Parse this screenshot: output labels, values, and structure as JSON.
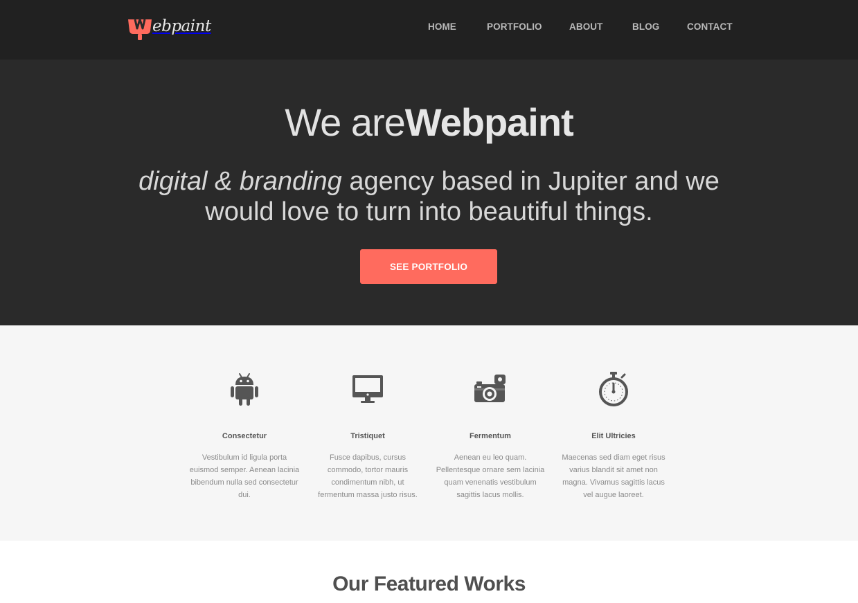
{
  "brand": {
    "name": "ebpaint",
    "logo_icon": "paint-brush-w-icon",
    "accent": "#ff6b5e"
  },
  "nav": {
    "items": [
      {
        "label": "HOME"
      },
      {
        "label": "PORTFOLIO"
      },
      {
        "label": "ABOUT"
      },
      {
        "label": "BLOG"
      },
      {
        "label": "CONTACT"
      }
    ]
  },
  "hero": {
    "title_light": "We are",
    "title_bold": "Webpaint",
    "subtitle_em": "digital & branding",
    "subtitle_rest": " agency based in Jupiter and we would love to turn into beautiful things.",
    "cta_label": "SEE PORTFOLIO"
  },
  "features": [
    {
      "icon": "android-icon",
      "title": "Consectetur",
      "text": "Vestibulum id ligula porta euismod semper. Aenean lacinia bibendum nulla sed consectetur dui."
    },
    {
      "icon": "monitor-icon",
      "title": "Tristiquet",
      "text": "Fusce dapibus, cursus commodo, tortor mauris condimentum nibh, ut fermentum massa justo risus."
    },
    {
      "icon": "camera-icon",
      "title": "Fermentum",
      "text": "Aenean eu leo quam. Pellentesque ornare sem lacinia quam venenatis vestibulum sagittis lacus mollis."
    },
    {
      "icon": "stopwatch-icon",
      "title": "Elit Ultricies",
      "text": "Maecenas sed diam eget risus varius blandit sit amet non magna. Vivamus sagittis lacus vel augue laoreet."
    }
  ],
  "featured": {
    "heading": "Our Featured Works"
  }
}
